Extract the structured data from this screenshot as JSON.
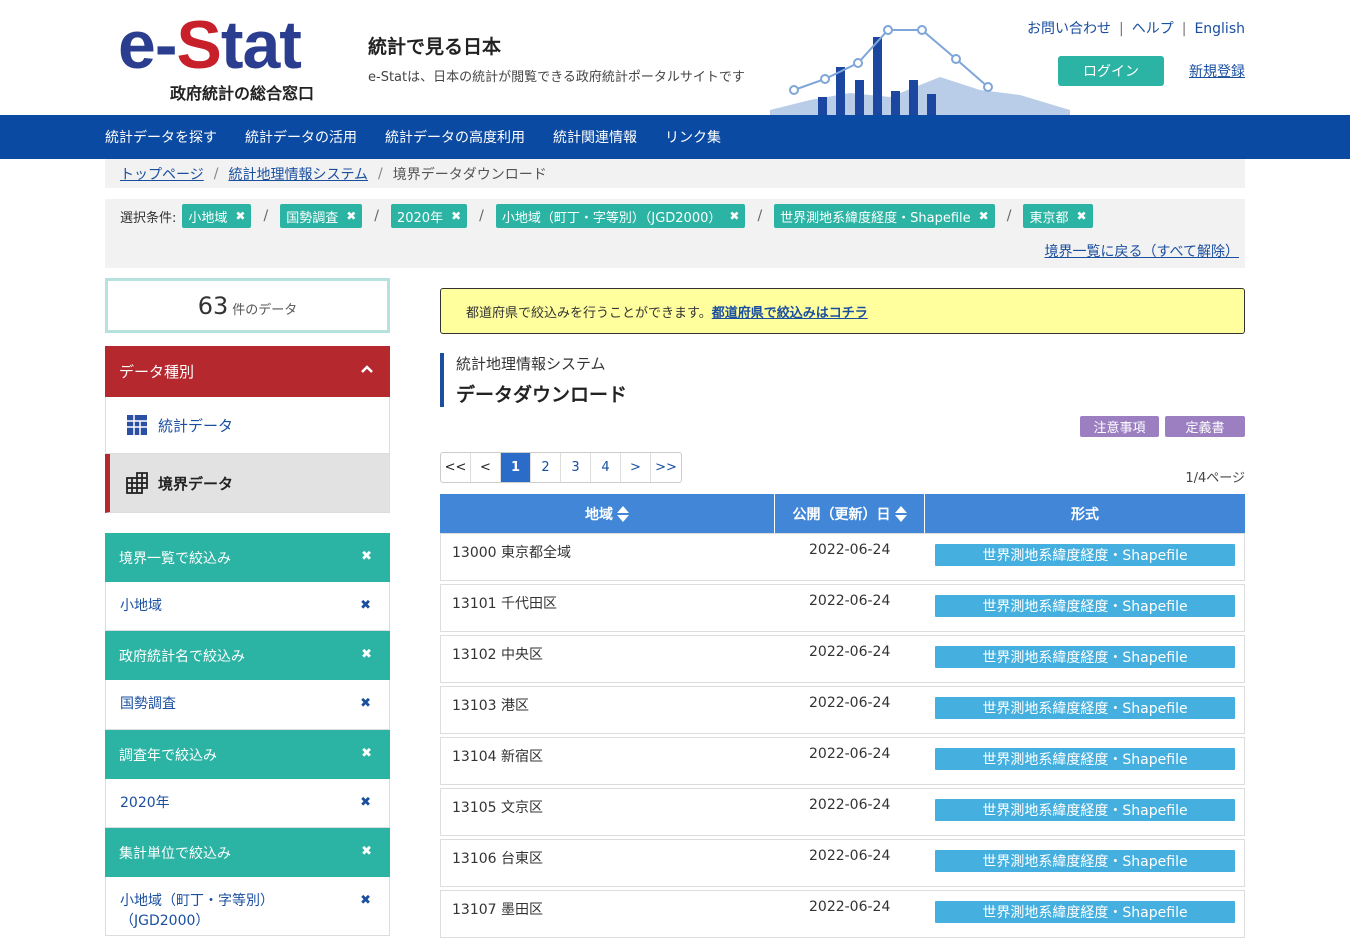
{
  "header": {
    "logo_text_1": "e-",
    "logo_text_2": "S",
    "logo_text_3": "tat",
    "logo_sub": "政府統計の総合窓口",
    "site_title": "統計で見る日本",
    "site_desc": "e-Statは、日本の統計が閲覧できる政府統計ポータルサイトです",
    "links": [
      "お問い合わせ",
      "ヘルプ",
      "English"
    ],
    "login_label": "ログイン",
    "register_label": "新規登録"
  },
  "nav": [
    "統計データを探す",
    "統計データの活用",
    "統計データの高度利用",
    "統計関連情報",
    "リンク集"
  ],
  "breadcrumb": {
    "items": [
      "トップページ",
      "統計地理情報システム"
    ],
    "current": "境界データダウンロード"
  },
  "conditions": {
    "label": "選択条件:",
    "chips": [
      "小地域",
      "国勢調査",
      "2020年",
      "小地域（町丁・字等別）（JGD2000）",
      "世界測地系緯度経度・Shapefile",
      "東京都"
    ],
    "back_label": "境界一覧に戻る（すべて解除）"
  },
  "sidebar": {
    "count": "63",
    "count_unit": "件のデータ",
    "type_head": "データ種別",
    "type_items": [
      "統計データ",
      "境界データ"
    ],
    "filters": [
      {
        "head": "境界一覧で絞込み",
        "value": "小地域"
      },
      {
        "head": "政府統計名で絞込み",
        "value": "国勢調査"
      },
      {
        "head": "調査年で絞込み",
        "value": "2020年"
      },
      {
        "head": "集計単位で絞込み",
        "value": "小地域（町丁・字等別）（JGD2000）"
      }
    ]
  },
  "main": {
    "notice_text": "都道府県で絞込みを行うことができます。",
    "notice_link": "都道府県で絞込みはコチラ",
    "system_label": "統計地理情報システム",
    "page_title": "データダウンロード",
    "tag_buttons": [
      "注意事項",
      "定義書"
    ],
    "pager": [
      "<<",
      "<",
      "1",
      "2",
      "3",
      "4",
      ">",
      ">>"
    ],
    "page_count": "1/4ページ",
    "columns": [
      "地域",
      "公開（更新）日",
      "形式"
    ],
    "rows": [
      {
        "area": "13000 東京都全域",
        "date": "2022-06-24",
        "format": "世界測地系緯度経度・Shapefile"
      },
      {
        "area": "13101 千代田区",
        "date": "2022-06-24",
        "format": "世界測地系緯度経度・Shapefile"
      },
      {
        "area": "13102 中央区",
        "date": "2022-06-24",
        "format": "世界測地系緯度経度・Shapefile"
      },
      {
        "area": "13103 港区",
        "date": "2022-06-24",
        "format": "世界測地系緯度経度・Shapefile"
      },
      {
        "area": "13104 新宿区",
        "date": "2022-06-24",
        "format": "世界測地系緯度経度・Shapefile"
      },
      {
        "area": "13105 文京区",
        "date": "2022-06-24",
        "format": "世界測地系緯度経度・Shapefile"
      },
      {
        "area": "13106 台東区",
        "date": "2022-06-24",
        "format": "世界測地系緯度経度・Shapefile"
      },
      {
        "area": "13107 墨田区",
        "date": "2022-06-24",
        "format": "世界測地系緯度経度・Shapefile"
      }
    ]
  },
  "colors": {
    "nav_bg": "#0b4aa2",
    "teal": "#2bb3a3",
    "red": "#b5282e",
    "table_head": "#4186d7",
    "format_btn": "#45b0df",
    "purple": "#9b7fc0",
    "notice_bg": "#ffff9e"
  }
}
